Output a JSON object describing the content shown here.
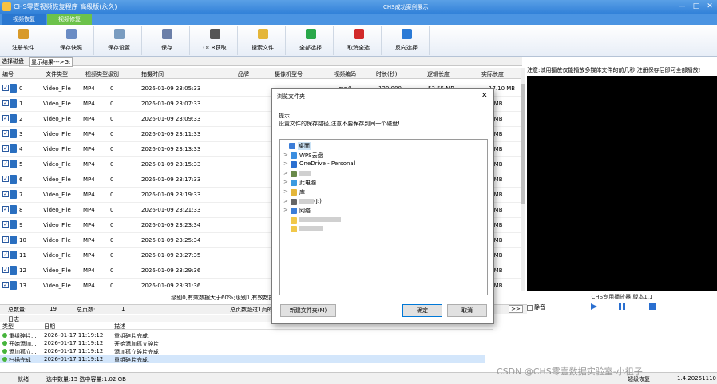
{
  "window": {
    "title": "CHS零壹视频恢复程序 高级版(永久)",
    "link": "CHS成功案例展示",
    "controls": [
      "—",
      "□",
      "✕"
    ]
  },
  "tabs": [
    "视频恢复",
    "视频修复"
  ],
  "toolbar": [
    {
      "label": "注册软件",
      "icon": "key-icon",
      "color": "#d89a2a"
    },
    {
      "label": "保存快照",
      "icon": "camera-save-icon",
      "color": "#6a8cc4"
    },
    {
      "label": "保存设置",
      "icon": "settings-save-icon",
      "color": "#7a9cc0"
    },
    {
      "label": "保存",
      "icon": "disk-save-icon",
      "color": "#6b7fa8"
    },
    {
      "label": "OCR获取",
      "icon": "ocr-icon",
      "color": "#555555"
    },
    {
      "label": "搜索文件",
      "icon": "folder-search-icon",
      "color": "#e4b63a"
    },
    {
      "label": "全部选择",
      "icon": "check-all-icon",
      "color": "#2aa84a"
    },
    {
      "label": "取消全选",
      "icon": "uncheck-all-icon",
      "color": "#d22a2a"
    },
    {
      "label": "反向选择",
      "icon": "invert-select-icon",
      "color": "#2a7ad6"
    }
  ],
  "path": {
    "disk_label": "选择磁盘",
    "result_label": "显示结果--->G:"
  },
  "player_notice": "注意:试用播放仅能播放多媒体文件的前几秒,注册保存后即可全部播放!",
  "table": {
    "columns": [
      "编号",
      "文件类型",
      "视频类型",
      "级别",
      "拍摄时间",
      "品牌",
      "摄像机型号",
      "视频编码",
      "时长(秒)",
      "逻辑长度",
      "实际长度"
    ],
    "rows": [
      {
        "id": "0",
        "ftype": "Video_File",
        "vtype": "MP4",
        "level": "0",
        "time": "2026-01-09 23:05:33",
        "size": "17.10 MB"
      },
      {
        "id": "1",
        "ftype": "Video_File",
        "vtype": "MP4",
        "level": "0",
        "time": "2026-01-09 23:07:33",
        "size": "3 MB"
      },
      {
        "id": "2",
        "ftype": "Video_File",
        "vtype": "MP4",
        "level": "0",
        "time": "2026-01-09 23:09:33",
        "size": "3 MB"
      },
      {
        "id": "3",
        "ftype": "Video_File",
        "vtype": "MP4",
        "level": "0",
        "time": "2026-01-09 23:11:33",
        "size": "3 MB"
      },
      {
        "id": "4",
        "ftype": "Video_File",
        "vtype": "MP4",
        "level": "0",
        "time": "2026-01-09 23:13:33",
        "size": "3 MB"
      },
      {
        "id": "5",
        "ftype": "Video_File",
        "vtype": "MP4",
        "level": "0",
        "time": "2026-01-09 23:15:33",
        "size": "3 MB"
      },
      {
        "id": "6",
        "ftype": "Video_File",
        "vtype": "MP4",
        "level": "0",
        "time": "2026-01-09 23:17:33",
        "size": "3 MB"
      },
      {
        "id": "7",
        "ftype": "Video_File",
        "vtype": "MP4",
        "level": "0",
        "time": "2026-01-09 23:19:33",
        "size": "3 MB"
      },
      {
        "id": "8",
        "ftype": "Video_File",
        "vtype": "MP4",
        "level": "0",
        "time": "2026-01-09 23:21:33",
        "size": "3 MB"
      },
      {
        "id": "9",
        "ftype": "Video_File",
        "vtype": "MP4",
        "level": "0",
        "time": "2026-01-09 23:23:34",
        "size": "3 MB"
      },
      {
        "id": "10",
        "ftype": "Video_File",
        "vtype": "MP4",
        "level": "0",
        "time": "2026-01-09 23:25:34",
        "size": "3 MB"
      },
      {
        "id": "11",
        "ftype": "Video_File",
        "vtype": "MP4",
        "level": "0",
        "time": "2026-01-09 23:27:35",
        "size": "7 MB"
      },
      {
        "id": "12",
        "ftype": "Video_File",
        "vtype": "MP4",
        "level": "0",
        "time": "2026-01-09 23:29:36",
        "size": "3 MB"
      },
      {
        "id": "13",
        "ftype": "Video_File",
        "vtype": "MP4",
        "level": "0",
        "time": "2026-01-09 23:31:36",
        "size": "3 MB"
      }
    ],
    "first_row_partial": {
      "codec": "mp4",
      "duration": "120.000",
      "logical": "53.55 MB"
    }
  },
  "level_legend": "级别0,有效数据大于60%;级别1,有效数据大于30%小于50%;级别2,有效",
  "counts": {
    "total_label": "总数量:",
    "total": "19",
    "pages_label": "总页数:",
    "pages": "1",
    "note": "总页数超过1页的",
    "next": ">>"
  },
  "player": {
    "title": "CHS专用播放器 版本1.1",
    "mute": "静音"
  },
  "log": {
    "title": "日志",
    "columns": [
      "类型",
      "日期",
      "描述"
    ],
    "rows": [
      {
        "type": "重组碎片...",
        "date": "2026-01-17 11:19:12",
        "desc": "重组碎片完成."
      },
      {
        "type": "开始添加...",
        "date": "2026-01-17 11:19:12",
        "desc": "开始添加孤立碎片"
      },
      {
        "type": "添加孤立...",
        "date": "2026-01-17 11:19:12",
        "desc": "添加孤立碎片完成"
      },
      {
        "type": "扫描完成",
        "date": "2026-01-17 11:19:12",
        "desc": "重组碎片完成."
      }
    ]
  },
  "status": {
    "ready": "就绪",
    "selection": "选中数量:15 选中容量:1.02 GB",
    "right": "超级恢复",
    "version": "1.4.20251110"
  },
  "watermark": "CSDN @CHS零壹数据实验室-小祖子",
  "dialog": {
    "title": "浏览文件夹",
    "close": "✕",
    "hint_title": "提示",
    "hint": "设置文件的保存路径,注意不要保存到同一个磁盘!",
    "tree": [
      {
        "label": "桌面",
        "icon": "desktop-icon",
        "color": "#3b7dd8",
        "level": 0,
        "arrow": "",
        "selected": true
      },
      {
        "label": "WPS云盘",
        "icon": "cloud-icon",
        "color": "#3b8ee0",
        "level": 1,
        "arrow": ">"
      },
      {
        "label": "OneDrive - Personal",
        "icon": "onedrive-icon",
        "color": "#2a6fd0",
        "level": 1,
        "arrow": ">"
      },
      {
        "label": "",
        "icon": "user-icon",
        "color": "#6a8a4a",
        "level": 1,
        "arrow": ">",
        "blur": 14
      },
      {
        "label": "此电脑",
        "icon": "computer-icon",
        "color": "#3b9ae0",
        "level": 1,
        "arrow": ">"
      },
      {
        "label": "库",
        "icon": "library-icon",
        "color": "#e4b63a",
        "level": 1,
        "arrow": ">"
      },
      {
        "label": "(J:)",
        "icon": "drive-icon",
        "color": "#666666",
        "level": 1,
        "arrow": ">",
        "blur": 18
      },
      {
        "label": "网络",
        "icon": "network-icon",
        "color": "#3b7dd8",
        "level": 1,
        "arrow": ">"
      },
      {
        "label": "",
        "icon": "folder-icon",
        "color": "#f1c84a",
        "level": 1,
        "arrow": "",
        "blur": 52
      },
      {
        "label": "",
        "icon": "folder-icon",
        "color": "#f1c84a",
        "level": 1,
        "arrow": "",
        "blur": 30
      }
    ],
    "new_folder": "新建文件夹(M)",
    "ok": "确定",
    "cancel": "取消"
  }
}
